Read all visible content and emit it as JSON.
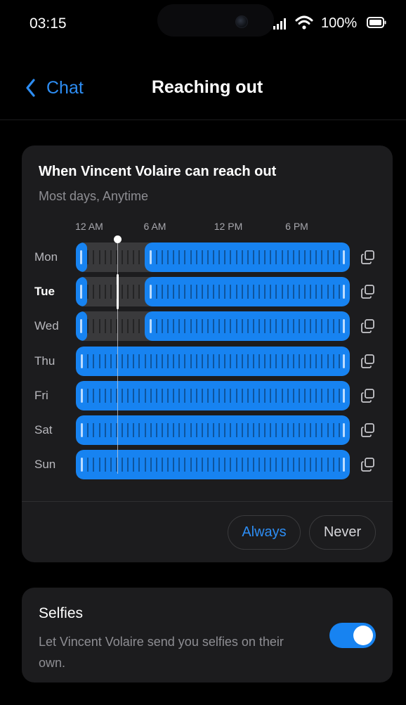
{
  "status_bar": {
    "time": "03:15",
    "battery": "100%"
  },
  "nav": {
    "back_label": "Chat",
    "title": "Reaching out"
  },
  "schedule": {
    "heading": "When Vincent Volaire can reach out",
    "subtitle": "Most days, Anytime",
    "time_labels": [
      "12 AM",
      "6 AM",
      "12 PM",
      "6 PM"
    ],
    "days": [
      {
        "label": "Mon",
        "today": false,
        "segments": [
          [
            0,
            1
          ],
          [
            6,
            24
          ]
        ]
      },
      {
        "label": "Tue",
        "today": true,
        "segments": [
          [
            0,
            1
          ],
          [
            6,
            24
          ]
        ]
      },
      {
        "label": "Wed",
        "today": false,
        "segments": [
          [
            0,
            1
          ],
          [
            6,
            24
          ]
        ]
      },
      {
        "label": "Thu",
        "today": false,
        "segments": [
          [
            0,
            24
          ]
        ]
      },
      {
        "label": "Fri",
        "today": false,
        "segments": [
          [
            0,
            24
          ]
        ]
      },
      {
        "label": "Sat",
        "today": false,
        "segments": [
          [
            0,
            24
          ]
        ]
      },
      {
        "label": "Sun",
        "today": false,
        "segments": [
          [
            0,
            24
          ]
        ]
      }
    ],
    "current_time_hour": 3.25,
    "always_label": "Always",
    "never_label": "Never"
  },
  "selfies": {
    "title": "Selfies",
    "description": "Let Vincent Volaire send you selfies on their own.",
    "enabled": true
  },
  "colors": {
    "accent": "#1783f1",
    "link": "#2d8df3",
    "card": "#1c1c1e",
    "background": "#000000"
  }
}
